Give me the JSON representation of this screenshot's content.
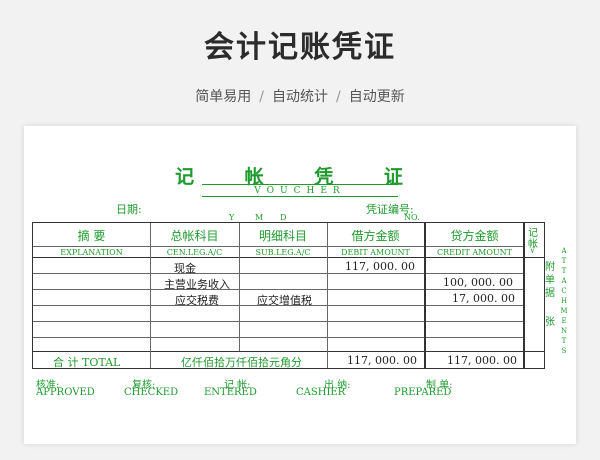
{
  "header": {
    "title": "会计记账凭证",
    "tagline": [
      "简单易用",
      "自动统计",
      "自动更新"
    ],
    "separator": "/"
  },
  "voucher": {
    "title": "记 帐 凭 证",
    "title_en": "VOUCHER",
    "date_label": "日期:",
    "ymd": [
      "Y",
      "M",
      "D"
    ],
    "number_label": "凭证编号:",
    "number_en": "NO."
  },
  "columns": {
    "summary": {
      "cn": "摘    要",
      "en": "EXPLANATION"
    },
    "general": {
      "cn": "总帐科目",
      "en": "CEN.LEG.A/C"
    },
    "detail": {
      "cn": "明细科目",
      "en": "SUB.LEG.A/C"
    },
    "debit": {
      "cn": "借方金额",
      "en": "DEBIT AMOUNT"
    },
    "credit": {
      "cn": "贷方金额",
      "en": "CREDIT AMOUNT"
    },
    "posted": {
      "cn1": "记",
      "cn2": "帐",
      "mark": "√"
    }
  },
  "rows": [
    {
      "general": "现金",
      "detail": "",
      "debit": "117, 000. 00",
      "credit": ""
    },
    {
      "general": "主营业务收入",
      "detail": "",
      "debit": "",
      "credit": "100, 000. 00"
    },
    {
      "general": "应交税费",
      "detail": "应交增值税",
      "debit": "",
      "credit": "17, 000. 00"
    }
  ],
  "total": {
    "label": "合 计 TOTAL",
    "caps_label": "亿仟佰拾万仟佰拾元角分",
    "debit": "117, 000. 00",
    "credit": "117, 000. 00"
  },
  "attachments": {
    "cn_top": "附",
    "cn_mid1": "单",
    "cn_mid2": "据",
    "cn_bottom": "张",
    "en": "ATTACHMENTS"
  },
  "signatures": [
    {
      "cn": "核准:",
      "en": "APPROVED"
    },
    {
      "cn": "复核:",
      "en": "CHECKED"
    },
    {
      "cn": "记 帐:",
      "en": "ENTERED"
    },
    {
      "cn": "出 纳:",
      "en": "CASHIER"
    },
    {
      "cn": "制 单:",
      "en": "PREPARED"
    }
  ],
  "colors": {
    "accent": "#1f9a2e",
    "background": "#f2f2f2",
    "title": "#2b2b2b"
  }
}
